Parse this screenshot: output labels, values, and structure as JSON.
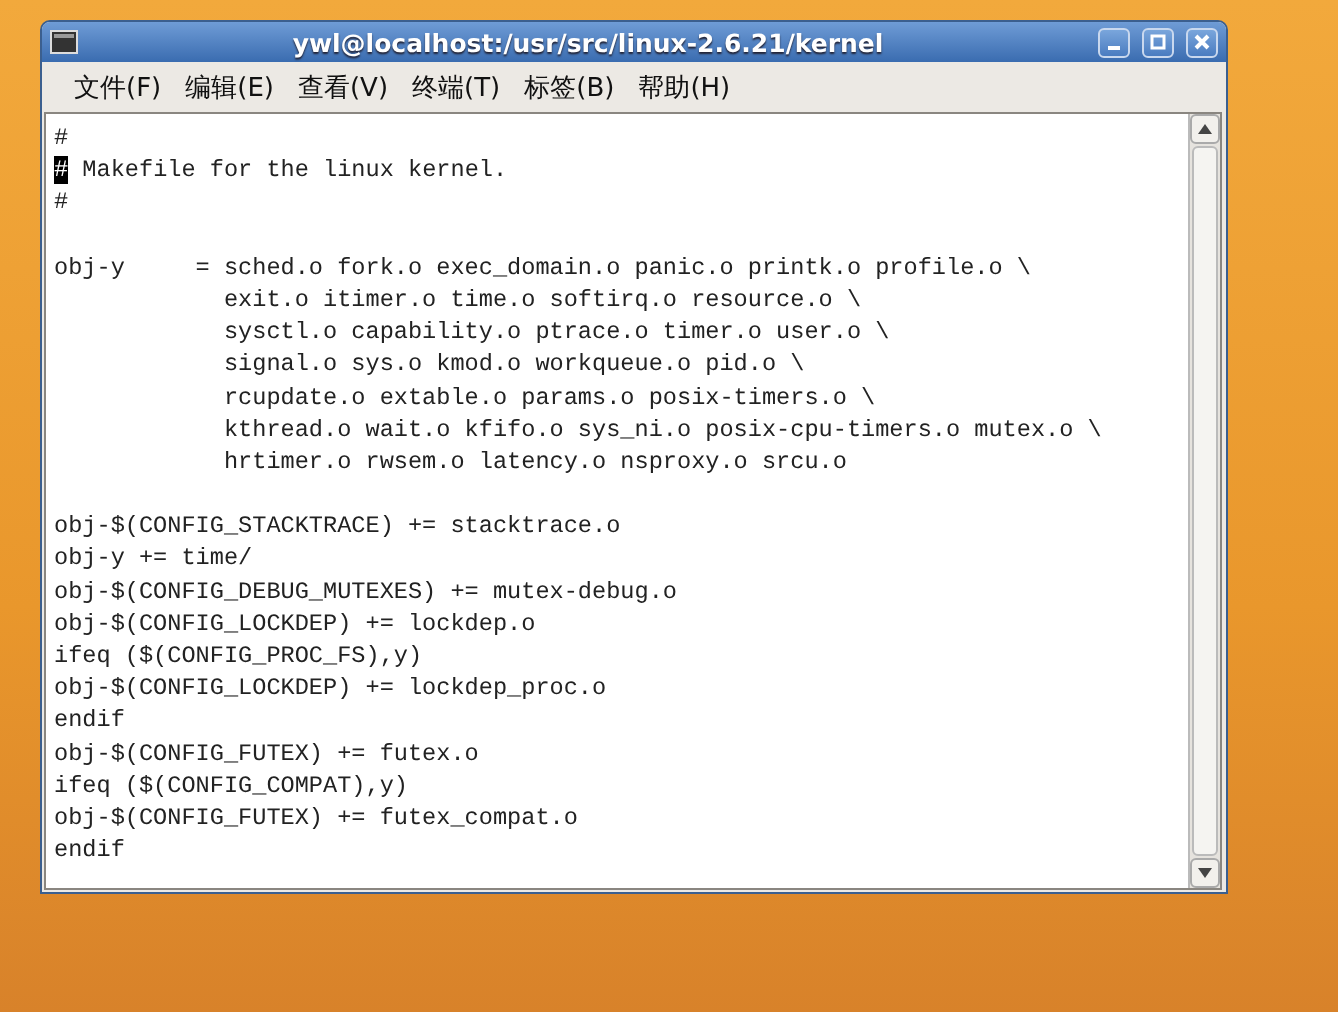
{
  "window": {
    "title": "ywl@localhost:/usr/src/linux-2.6.21/kernel"
  },
  "menu": [
    "文件(F)",
    "编辑(E)",
    "查看(V)",
    "终端(T)",
    "标签(B)",
    "帮助(H)"
  ],
  "terminal": {
    "lines": [
      {
        "kind": "text",
        "text": "#"
      },
      {
        "kind": "cursor",
        "text": "# Makefile for the linux kernel."
      },
      {
        "kind": "text",
        "text": "#"
      },
      {
        "kind": "blank"
      },
      {
        "kind": "text",
        "text": "obj-y     = sched.o fork.o exec_domain.o panic.o printk.o profile.o \\"
      },
      {
        "kind": "text",
        "text": "            exit.o itimer.o time.o softirq.o resource.o \\"
      },
      {
        "kind": "text",
        "text": "            sysctl.o capability.o ptrace.o timer.o user.o \\"
      },
      {
        "kind": "text",
        "text": "            signal.o sys.o kmod.o workqueue.o pid.o \\"
      },
      {
        "kind": "text",
        "text": "            rcupdate.o extable.o params.o posix-timers.o \\"
      },
      {
        "kind": "text",
        "text": "            kthread.o wait.o kfifo.o sys_ni.o posix-cpu-timers.o mutex.o \\"
      },
      {
        "kind": "text",
        "text": "            hrtimer.o rwsem.o latency.o nsproxy.o srcu.o"
      },
      {
        "kind": "blank"
      },
      {
        "kind": "text",
        "text": "obj-$(CONFIG_STACKTRACE) += stacktrace.o"
      },
      {
        "kind": "text",
        "text": "obj-y += time/"
      },
      {
        "kind": "text",
        "text": "obj-$(CONFIG_DEBUG_MUTEXES) += mutex-debug.o"
      },
      {
        "kind": "text",
        "text": "obj-$(CONFIG_LOCKDEP) += lockdep.o"
      },
      {
        "kind": "text",
        "text": "ifeq ($(CONFIG_PROC_FS),y)"
      },
      {
        "kind": "text",
        "text": "obj-$(CONFIG_LOCKDEP) += lockdep_proc.o"
      },
      {
        "kind": "text",
        "text": "endif"
      },
      {
        "kind": "text",
        "text": "obj-$(CONFIG_FUTEX) += futex.o"
      },
      {
        "kind": "text",
        "text": "ifeq ($(CONFIG_COMPAT),y)"
      },
      {
        "kind": "text",
        "text": "obj-$(CONFIG_FUTEX) += futex_compat.o"
      },
      {
        "kind": "text",
        "text": "endif"
      }
    ]
  }
}
